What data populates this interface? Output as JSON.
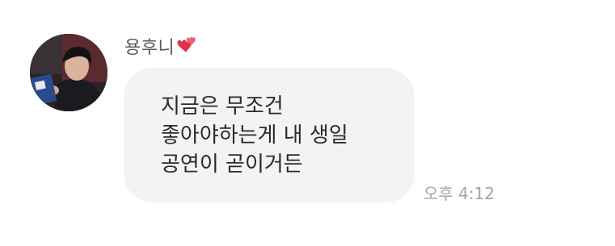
{
  "sender": {
    "name": "용후니",
    "name_icon": "double-heart-icon",
    "avatar_icon": "profile-photo-avatar"
  },
  "message": {
    "lines": [
      "지금은 무조건",
      "좋아야하는게 내 생일",
      "공연이 곧이거든"
    ],
    "timestamp": "오후 4:12"
  },
  "colors": {
    "bubble": "#f3f3f5",
    "text": "#2a2a2d",
    "sender_name": "#5a5a5f",
    "timestamp": "#a4a4aa",
    "heart": "#e0334d"
  }
}
